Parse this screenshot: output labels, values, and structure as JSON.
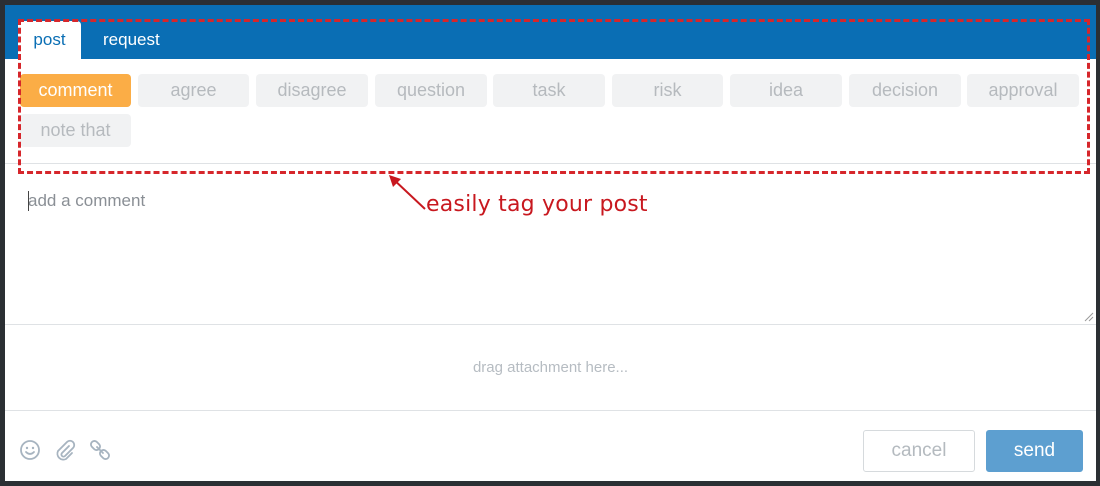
{
  "tabs": [
    {
      "label": "post",
      "active": true
    },
    {
      "label": "request",
      "active": false
    }
  ],
  "tags": [
    {
      "label": "comment",
      "active": true
    },
    {
      "label": "agree"
    },
    {
      "label": "disagree"
    },
    {
      "label": "question"
    },
    {
      "label": "task"
    },
    {
      "label": "risk"
    },
    {
      "label": "idea"
    },
    {
      "label": "decision"
    },
    {
      "label": "approval"
    },
    {
      "label": "note that"
    }
  ],
  "comment": {
    "placeholder": "add a comment"
  },
  "dropzone": {
    "label": "drag attachment here..."
  },
  "footer": {
    "icons": [
      "smiley-icon",
      "paperclip-icon",
      "link-icon"
    ],
    "cancel_label": "cancel",
    "send_label": "send"
  },
  "annotation": {
    "text": "easily tag your post"
  },
  "colors": {
    "header": "#0a6eb4",
    "active_tag": "#fbad46",
    "send": "#5d9fd0",
    "annotation": "#d6262b"
  }
}
